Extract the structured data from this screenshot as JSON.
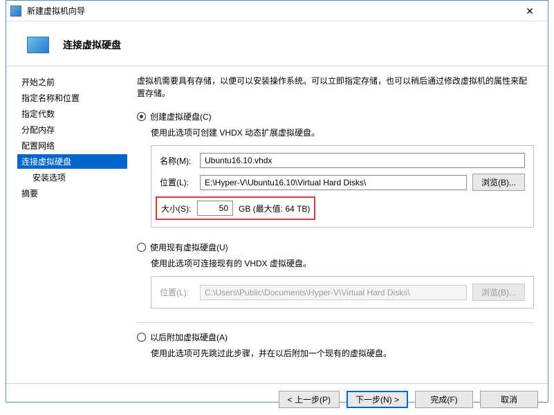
{
  "window": {
    "title": "新建虚拟机向导"
  },
  "header": {
    "title": "连接虚拟硬盘"
  },
  "sidebar": {
    "items": [
      {
        "label": "开始之前"
      },
      {
        "label": "指定名称和位置"
      },
      {
        "label": "指定代数"
      },
      {
        "label": "分配内存"
      },
      {
        "label": "配置网络"
      },
      {
        "label": "连接虚拟硬盘"
      },
      {
        "label": "安装选项"
      },
      {
        "label": "摘要"
      }
    ]
  },
  "content": {
    "description": "虚拟机需要具有存储，以便可以安装操作系统。可以立即指定存储，也可以稍后通过修改虚拟机的属性来配置存储。",
    "opt_create": {
      "label": "创建虚拟硬盘(C)",
      "desc": "使用此选项可创建 VHDX 动态扩展虚拟硬盘。",
      "name_label": "名称(M):",
      "name_value": "Ubuntu16.10.vhdx",
      "loc_label": "位置(L):",
      "loc_value": "E:\\Hyper-V\\Ubuntu16.10\\Virtual Hard Disks\\",
      "browse": "浏览(B)...",
      "size_label": "大小(S):",
      "size_value": "50",
      "size_unit": "GB (最大值: 64 TB)"
    },
    "opt_existing": {
      "label": "使用现有虚拟硬盘(U)",
      "desc": "使用此选项可连接现有的 VHDX 虚拟硬盘。",
      "loc_label": "位置(L):",
      "loc_value": "C:\\Users\\Public\\Documents\\Hyper-V\\Virtual Hard Disks\\",
      "browse": "浏览(B)..."
    },
    "opt_later": {
      "label": "以后附加虚拟硬盘(A)",
      "desc": "使用此选项可先跳过此步骤，并在以后附加一个现有的虚拟硬盘。"
    }
  },
  "footer": {
    "prev": "< 上一步(P)",
    "next": "下一步(N) >",
    "finish": "完成(F)",
    "cancel": "取消"
  }
}
